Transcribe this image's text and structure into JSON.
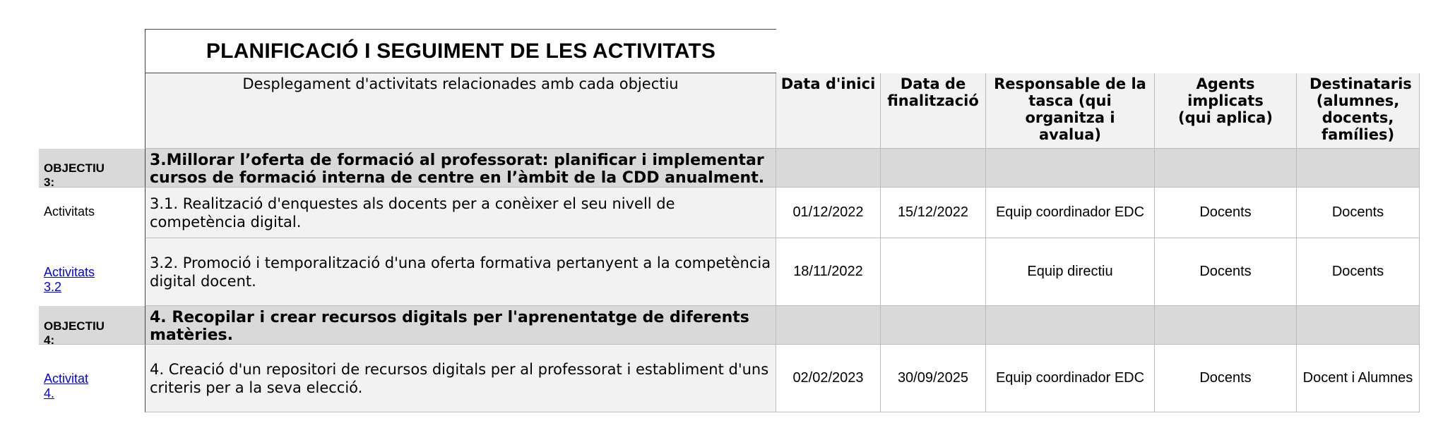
{
  "title": "PLANIFICACIÓ I SEGUIMENT DE LES ACTIVITATS",
  "headers": {
    "description": "Desplegament d'activitats relacionades amb cada objectiu",
    "start_date": "Data d'inici",
    "end_date": "Data de finalització",
    "responsible": "Responsable de la tasca (qui organitza i avalua)",
    "agents": "Agents implicats (qui aplica)",
    "recipients": "Destinataris (alumnes, docents, famílies)"
  },
  "objective3": {
    "label": "OBJECTIU 3:",
    "text": "3.Millorar l’oferta de formació al professorat: planificar i implementar cursos de formació interna de centre en l’àmbit de la CDD anualment."
  },
  "row1": {
    "label": "Activitats",
    "text": "3.1. Realització d'enquestes als docents per a conèixer el seu nivell de competència digital.",
    "start": "01/12/2022",
    "end": "15/12/2022",
    "responsible": "Equip coordinador EDC",
    "agents": "Docents",
    "recipients": "Docents"
  },
  "row2": {
    "label": "Activitats 3.2",
    "text": "3.2. Promoció i temporalització d'una oferta formativa pertanyent a la competència digital docent.",
    "start": "18/11/2022",
    "end": "",
    "responsible": "Equip directiu",
    "agents": "Docents",
    "recipients": "Docents"
  },
  "objective4": {
    "label": "OBJECTIU 4:",
    "text": "4. Recopilar i crear recursos digitals per l'aprenentatge de diferents matèries."
  },
  "row3": {
    "label": "Activitat 4.",
    "text": "4. Creació d'un repositori de recursos digitals per al professorat i establiment d'uns criteris per a la seva elecció.",
    "start": "02/02/2023",
    "end": "30/09/2025",
    "responsible": "Equip coordinador EDC",
    "agents": "Docents",
    "recipients": "Docent i Alumnes"
  }
}
